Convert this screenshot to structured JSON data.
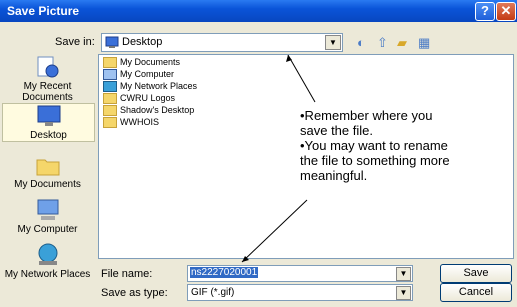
{
  "window": {
    "title": "Save Picture",
    "help_glyph": "?",
    "close_glyph": "✕"
  },
  "save_in": {
    "label": "Save in:",
    "value": "Desktop"
  },
  "places": [
    {
      "label": "My Recent Documents",
      "icon": "recent-documents-icon"
    },
    {
      "label": "Desktop",
      "icon": "desktop-icon"
    },
    {
      "label": "My Documents",
      "icon": "my-documents-icon"
    },
    {
      "label": "My Computer",
      "icon": "my-computer-icon"
    },
    {
      "label": "My Network Places",
      "icon": "network-places-icon"
    }
  ],
  "files": [
    {
      "name": "My Documents"
    },
    {
      "name": "My Computer"
    },
    {
      "name": "My Network Places"
    },
    {
      "name": "CWRU Logos"
    },
    {
      "name": "Shadow's Desktop"
    },
    {
      "name": "WWHOIS"
    }
  ],
  "annotation": {
    "bullets": [
      "•Remember where you save the file.",
      "•You may want to rename the file to something more meaningful."
    ]
  },
  "file_name": {
    "label": "File name:",
    "value": "ns2227020001"
  },
  "save_type": {
    "label": "Save as type:",
    "value": "GIF (*.gif)"
  },
  "buttons": {
    "save": "Save",
    "cancel": "Cancel"
  }
}
